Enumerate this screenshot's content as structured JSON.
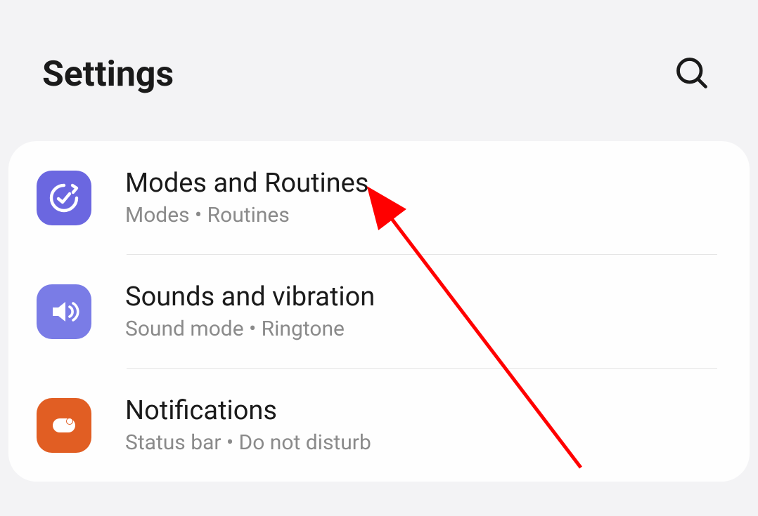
{
  "header": {
    "title": "Settings"
  },
  "settings": {
    "items": [
      {
        "title": "Modes and Routines",
        "subtitle": "Modes  •  Routines"
      },
      {
        "title": "Sounds and vibration",
        "subtitle": "Sound mode  •  Ringtone"
      },
      {
        "title": "Notifications",
        "subtitle": "Status bar  •  Do not disturb"
      }
    ]
  }
}
